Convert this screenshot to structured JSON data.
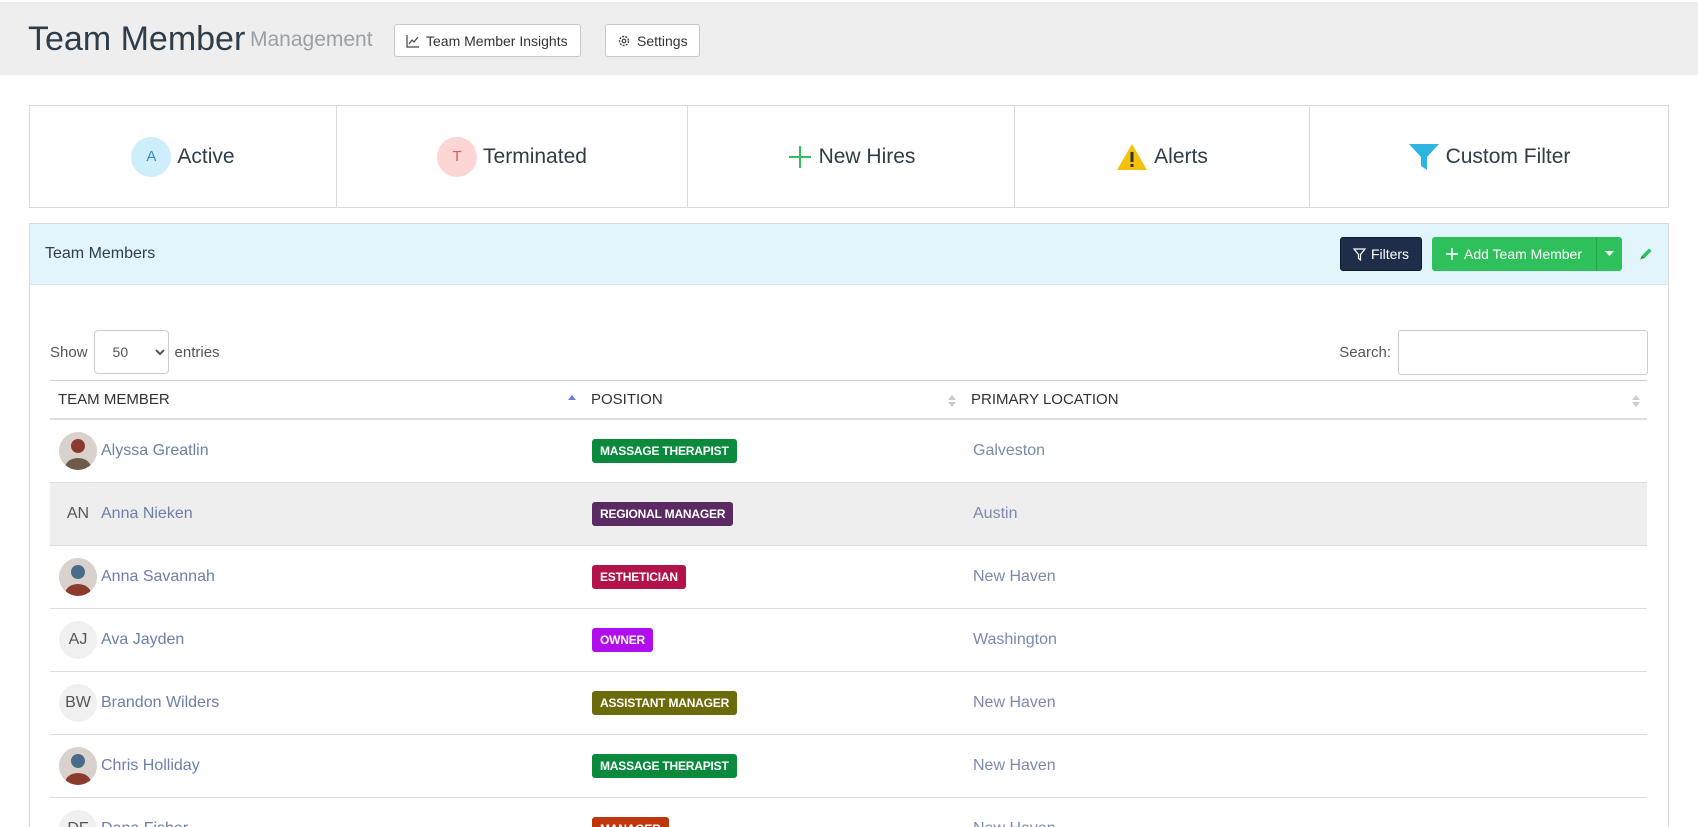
{
  "header": {
    "title": "Team Member",
    "subtitle": "Management",
    "insights_label": "Team Member Insights",
    "settings_label": "Settings"
  },
  "status_cards": {
    "active": {
      "label": "Active",
      "initial": "A"
    },
    "terminated": {
      "label": "Terminated",
      "initial": "T"
    },
    "new_hires": {
      "label": "New Hires"
    },
    "alerts": {
      "label": "Alerts"
    },
    "custom_filter": {
      "label": "Custom Filter"
    }
  },
  "panel": {
    "title": "Team Members",
    "filters_label": "Filters",
    "add_label": "Add Team Member"
  },
  "table_controls": {
    "show_label": "Show",
    "entries_value": "50",
    "entries_label": "entries",
    "search_label": "Search:",
    "search_value": ""
  },
  "table": {
    "columns": [
      "TEAM MEMBER",
      "POSITION",
      "PRIMARY LOCATION"
    ],
    "rows": [
      {
        "name": "Alyssa Greatlin",
        "initials": "",
        "avatar": "photo",
        "position": "MASSAGE THERAPIST",
        "color": "#0b8a3e",
        "location": "Galveston"
      },
      {
        "name": "Anna Nieken",
        "initials": "AN",
        "avatar": "initials",
        "position": "REGIONAL MANAGER",
        "color": "#5b2a63",
        "location": "Austin"
      },
      {
        "name": "Anna Savannah",
        "initials": "",
        "avatar": "photo",
        "position": "ESTHETICIAN",
        "color": "#b3124a",
        "location": "New Haven"
      },
      {
        "name": "Ava Jayden",
        "initials": "AJ",
        "avatar": "initials",
        "position": "OWNER",
        "color": "#b10ef0",
        "location": "Washington"
      },
      {
        "name": "Brandon Wilders",
        "initials": "BW",
        "avatar": "initials",
        "position": "ASSISTANT MANAGER",
        "color": "#6b6b0a",
        "location": "New Haven"
      },
      {
        "name": "Chris Holliday",
        "initials": "",
        "avatar": "photo",
        "position": "MASSAGE THERAPIST",
        "color": "#0b8a3e",
        "location": "New Haven"
      },
      {
        "name": "Dana Fisher",
        "initials": "DF",
        "avatar": "initials",
        "position": "MANAGER",
        "color": "#c0360c",
        "location": "New Haven"
      }
    ]
  },
  "colors": {
    "filters_button": "#1e2d4a",
    "add_button": "#2ec05b",
    "panel_header": "#e3f5fc"
  },
  "icons": [
    "chart-line-icon",
    "gear-icon",
    "plus-icon",
    "warning-icon",
    "funnel-icon",
    "filter-icon",
    "caret-down-icon",
    "pencil-icon",
    "sort-icon"
  ]
}
